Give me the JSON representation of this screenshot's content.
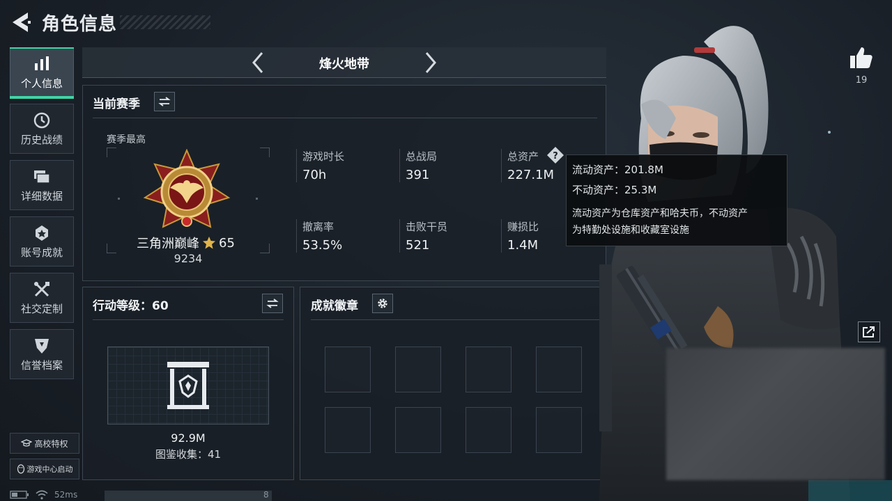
{
  "header": {
    "title": "角色信息",
    "back_icon": "back-arrow-icon"
  },
  "sidebar": {
    "items": [
      {
        "label": "个人信息",
        "icon": "bar-chart-icon",
        "active": true
      },
      {
        "label": "历史战绩",
        "icon": "clock-icon",
        "active": false
      },
      {
        "label": "详细数据",
        "icon": "folder-icon",
        "active": false
      },
      {
        "label": "账号成就",
        "icon": "medal-icon",
        "active": false
      },
      {
        "label": "社交定制",
        "icon": "tools-icon",
        "active": false
      },
      {
        "label": "信誉档案",
        "icon": "shield-icon",
        "active": false
      }
    ],
    "buttons": [
      {
        "label": "高校特权",
        "icon": "graduation-icon"
      },
      {
        "label": "游戏中心启动",
        "icon": "penguin-icon"
      }
    ],
    "accent_color": "#3fd4a6"
  },
  "status": {
    "ping": "52ms",
    "counter": "8"
  },
  "mode": {
    "label": "烽火地带"
  },
  "season": {
    "title": "当前赛季",
    "best_label": "赛季最高",
    "rank_name": "三角洲巅峰",
    "rank_stars": "65",
    "rank_score": "9234",
    "stats": [
      {
        "label": "游戏时长",
        "value": "70h"
      },
      {
        "label": "总战局",
        "value": "391"
      },
      {
        "label": "总资产",
        "value": "227.1M"
      },
      {
        "label": "撤离率",
        "value": "53.5%"
      },
      {
        "label": "击败干员",
        "value": "521"
      },
      {
        "label": "赚损比",
        "value": "1.4M"
      }
    ]
  },
  "tooltip": {
    "liquid": "流动资产：201.8M",
    "fixed": "不动资产：25.3M",
    "note_line1": "流动资产为仓库资产和哈夫币，不动资产",
    "note_line2": "为特勤处设施和收藏室设施"
  },
  "action_level": {
    "title": "行动等级：60",
    "value": "92.9M",
    "collection": "图鉴收集：41"
  },
  "achievements": {
    "title": "成就徽章",
    "slots": 8
  },
  "social": {
    "likes": "19"
  }
}
